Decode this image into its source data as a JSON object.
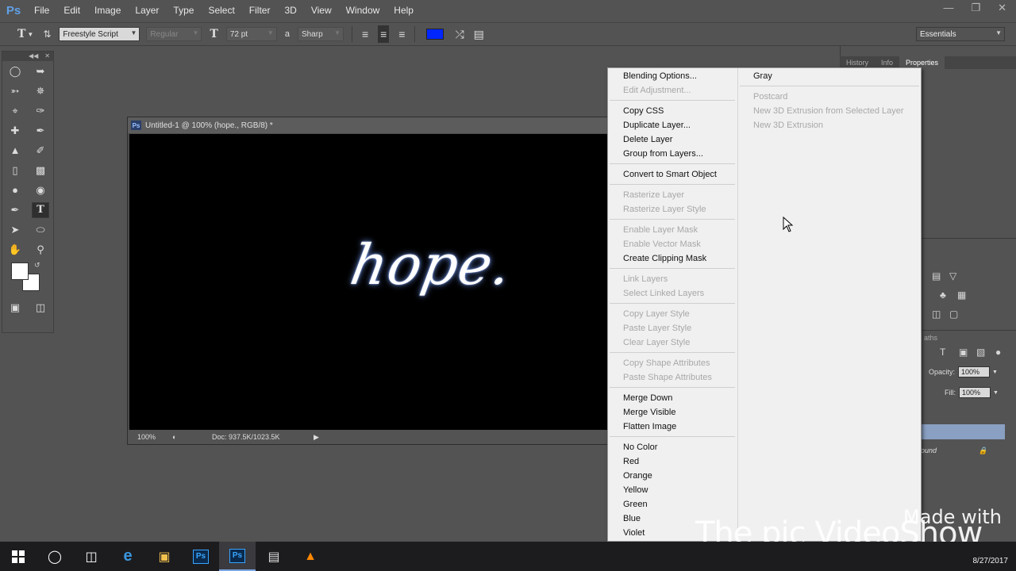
{
  "app": {
    "logo": "Ps"
  },
  "menubar": {
    "items": [
      "File",
      "Edit",
      "Image",
      "Layer",
      "Type",
      "Select",
      "Filter",
      "3D",
      "View",
      "Window",
      "Help"
    ]
  },
  "options": {
    "font_family": "Freestyle Script",
    "font_style": "Regular",
    "font_size": "72 pt",
    "aa_label": "a",
    "antialias": "Sharp",
    "text_color": "#0026ff",
    "workspace": "Essentials"
  },
  "document": {
    "tab_title": "Untitled-1 @ 100% (hope., RGB/8) *",
    "canvas_text": "hope.",
    "zoom": "100%",
    "doc_size": "Doc: 937.5K/1023.5K"
  },
  "right_panel": {
    "tabs": [
      "History",
      "Info",
      "Properties"
    ],
    "opacity_label": "Opacity:",
    "opacity_value": "100%",
    "fill_label": "Fill:",
    "fill_value": "100%",
    "paths_tab_partial": "aths",
    "layer_partial": "ound"
  },
  "context_menu": {
    "left": [
      {
        "label": "Blending Options...",
        "enabled": true
      },
      {
        "label": "Edit Adjustment...",
        "enabled": false
      },
      {
        "label": "Copy CSS",
        "enabled": true
      },
      {
        "label": "Duplicate Layer...",
        "enabled": true
      },
      {
        "label": "Delete Layer",
        "enabled": true
      },
      {
        "label": "Group from Layers...",
        "enabled": true
      },
      {
        "label": "Convert to Smart Object",
        "enabled": true
      },
      {
        "label": "Rasterize Layer",
        "enabled": false
      },
      {
        "label": "Rasterize Layer Style",
        "enabled": false
      },
      {
        "label": "Enable Layer Mask",
        "enabled": false
      },
      {
        "label": "Enable Vector Mask",
        "enabled": false
      },
      {
        "label": "Create Clipping Mask",
        "enabled": true
      },
      {
        "label": "Link Layers",
        "enabled": false
      },
      {
        "label": "Select Linked Layers",
        "enabled": false
      },
      {
        "label": "Copy Layer Style",
        "enabled": false
      },
      {
        "label": "Paste Layer Style",
        "enabled": false
      },
      {
        "label": "Clear Layer Style",
        "enabled": false
      },
      {
        "label": "Copy Shape Attributes",
        "enabled": false
      },
      {
        "label": "Paste Shape Attributes",
        "enabled": false
      },
      {
        "label": "Merge Down",
        "enabled": true
      },
      {
        "label": "Merge Visible",
        "enabled": true
      },
      {
        "label": "Flatten Image",
        "enabled": true
      },
      {
        "label": "No Color",
        "enabled": true
      },
      {
        "label": "Red",
        "enabled": true
      },
      {
        "label": "Orange",
        "enabled": true
      },
      {
        "label": "Yellow",
        "enabled": true
      },
      {
        "label": "Green",
        "enabled": true
      },
      {
        "label": "Blue",
        "enabled": true
      },
      {
        "label": "Violet",
        "enabled": true
      }
    ],
    "right": [
      {
        "label": "Gray",
        "enabled": true
      },
      {
        "label": "Postcard",
        "enabled": false
      },
      {
        "label": "New 3D Extrusion from Selected Layer",
        "enabled": false
      },
      {
        "label": "New 3D Extrusion",
        "enabled": false
      }
    ]
  },
  "watermark": {
    "made_with": "Made with",
    "name": "The pic VideoShow"
  },
  "taskbar": {
    "clock_date": "8/27/2017"
  }
}
